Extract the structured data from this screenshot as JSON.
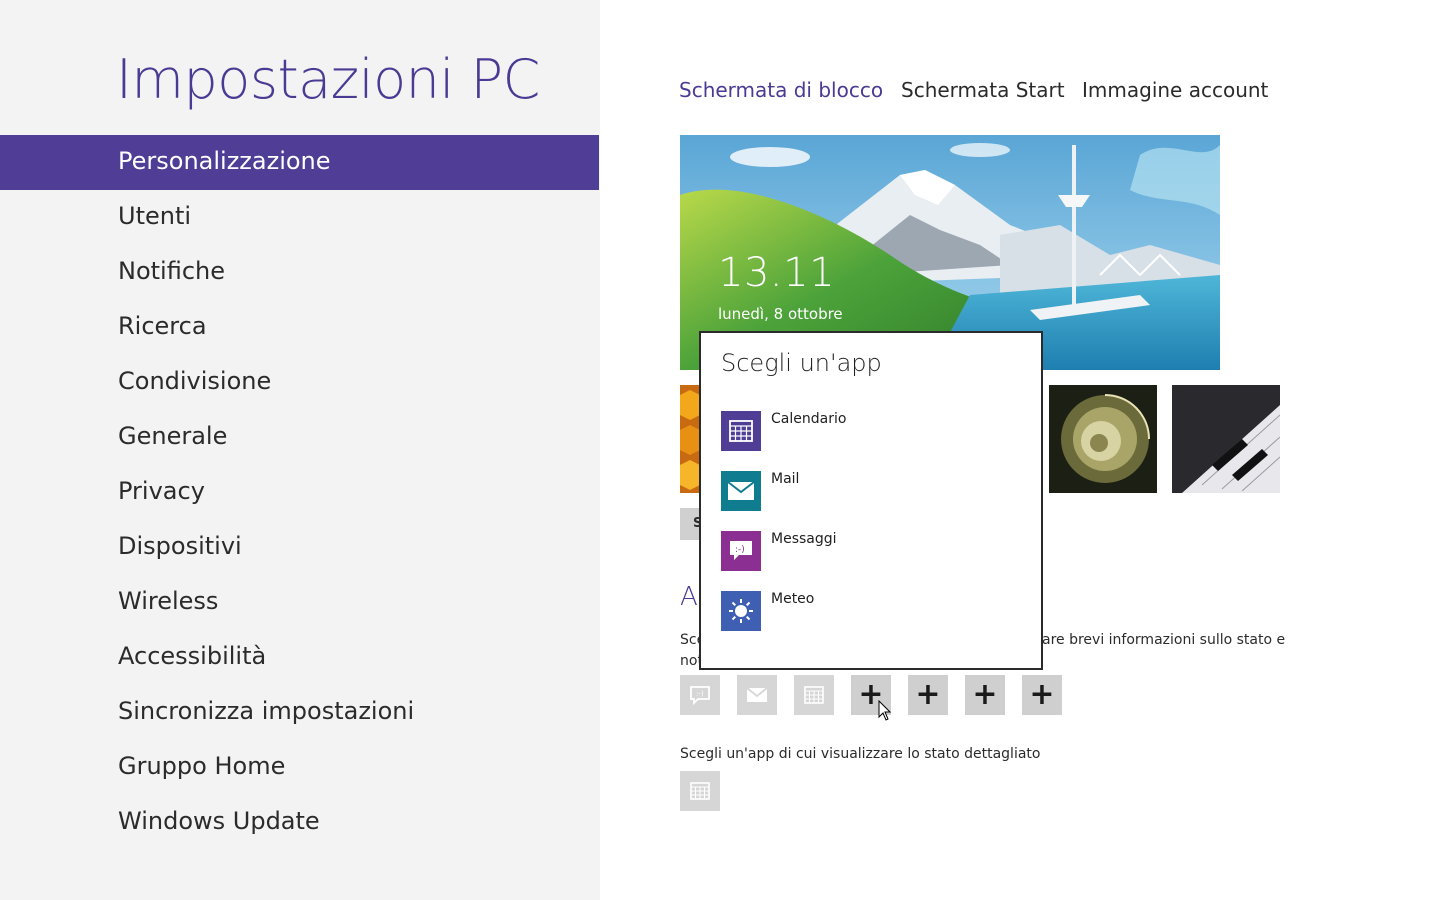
{
  "app_title": "Impostazioni PC",
  "nav": {
    "items": [
      {
        "label": "Personalizzazione",
        "active": true
      },
      {
        "label": "Utenti"
      },
      {
        "label": "Notifiche"
      },
      {
        "label": "Ricerca"
      },
      {
        "label": "Condivisione"
      },
      {
        "label": "Generale"
      },
      {
        "label": "Privacy"
      },
      {
        "label": "Dispositivi"
      },
      {
        "label": "Wireless"
      },
      {
        "label": "Accessibilità"
      },
      {
        "label": "Sincronizza impostazioni"
      },
      {
        "label": "Gruppo Home"
      },
      {
        "label": "Windows Update"
      }
    ]
  },
  "tabs": [
    {
      "label": "Schermata di blocco",
      "active": true
    },
    {
      "label": "Schermata Start"
    },
    {
      "label": "Immagine account"
    }
  ],
  "lock_preview": {
    "time": "13.11",
    "date": "lunedì, 8 ottobre"
  },
  "browse_button": {
    "label": "S"
  },
  "section": {
    "heading_partial": "A",
    "desc_left_partial": "Sce",
    "desc_left_partial_2": "not",
    "desc_right_partial": "are brevi informazioni sullo stato e"
  },
  "badge_slots": [
    {
      "icon": "messaging-icon",
      "filled": true
    },
    {
      "icon": "mail-icon",
      "filled": true
    },
    {
      "icon": "calendar-icon",
      "filled": true
    },
    {
      "icon": "plus-icon",
      "filled": false,
      "label": "+"
    },
    {
      "icon": "plus-icon",
      "filled": false,
      "label": "+"
    },
    {
      "icon": "plus-icon",
      "filled": false,
      "label": "+"
    },
    {
      "icon": "plus-icon",
      "filled": false,
      "label": "+"
    }
  ],
  "detail": {
    "label": "Scegli un'app di cui visualizzare lo stato dettagliato",
    "icon": "calendar-icon"
  },
  "flyout": {
    "title": "Scegli un'app",
    "apps": [
      {
        "label": "Calendario",
        "icon": "calendar-icon",
        "color": "#4f3d96"
      },
      {
        "label": "Mail",
        "icon": "mail-icon",
        "color": "#0f7c8f"
      },
      {
        "label": "Messaggi",
        "icon": "messaging-icon",
        "color": "#8b2f93"
      },
      {
        "label": "Meteo",
        "icon": "weather-icon",
        "color": "#3f5fb3"
      }
    ]
  },
  "colors": {
    "accent": "#4f3d96",
    "title": "#4b3a93",
    "left_pane_bg": "#f3f3f3"
  }
}
